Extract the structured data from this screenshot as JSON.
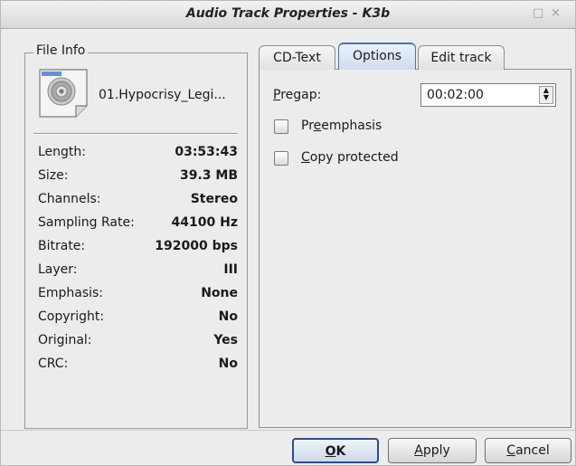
{
  "window": {
    "title": "Audio Track Properties - K3b",
    "controls": [
      "□",
      "×"
    ]
  },
  "file_info": {
    "legend": "File Info",
    "file_name": "01.Hypocrisy_Legi...",
    "icon": "audio-file-icon",
    "rows": [
      {
        "key": "Length:",
        "value": "03:53:43"
      },
      {
        "key": "Size:",
        "value": "39.3 MB"
      },
      {
        "key": "Channels:",
        "value": "Stereo"
      },
      {
        "key": "Sampling Rate:",
        "value": "44100 Hz"
      },
      {
        "key": "Bitrate:",
        "value": "192000 bps"
      },
      {
        "key": "Layer:",
        "value": "III"
      },
      {
        "key": "Emphasis:",
        "value": "None"
      },
      {
        "key": "Copyright:",
        "value": "No"
      },
      {
        "key": "Original:",
        "value": "Yes"
      },
      {
        "key": "CRC:",
        "value": "No"
      }
    ]
  },
  "tabs": [
    {
      "label": "CD-Text",
      "active": false
    },
    {
      "label": "Options",
      "active": true
    },
    {
      "label": "Edit track",
      "active": false
    }
  ],
  "options": {
    "pregap_label_mnemonic": "P",
    "pregap_label_rest": "regap:",
    "pregap_value": "00:02:00",
    "preemphasis_pre": "Pr",
    "preemphasis_mnemonic": "e",
    "preemphasis_post": "emphasis",
    "preemphasis_checked": false,
    "copy_protected_mnemonic": "C",
    "copy_protected_rest": "opy protected",
    "copy_protected_checked": false
  },
  "buttons": {
    "ok_mnemonic": "O",
    "ok_rest": "K",
    "apply_mnemonic": "A",
    "apply_rest": "pply",
    "cancel_mnemonic": "C",
    "cancel_rest": "ancel"
  }
}
